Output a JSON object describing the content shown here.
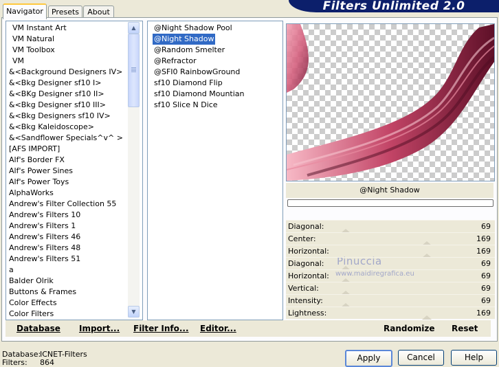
{
  "banner": {
    "title": "Filters Unlimited 2.0"
  },
  "tabs": [
    {
      "label": "Navigator",
      "active": true
    },
    {
      "label": "Presets",
      "active": false
    },
    {
      "label": "About",
      "active": false
    }
  ],
  "categories": [
    "VM Instant Art",
    "VM Natural",
    "VM Toolbox",
    "VM",
    "&<Background Designers IV>",
    "&<Bkg Designer sf10 I>",
    "&<BKg Designer sf10 II>",
    "&<Bkg Designer sf10 III>",
    "&<Bkg Designers sf10 IV>",
    "&<Bkg Kaleidoscope>",
    "&<Sandflower Specials^v^ >",
    "[AFS IMPORT]",
    "Alf's Border FX",
    "Alf's Power Sines",
    "Alf's Power Toys",
    "AlphaWorks",
    "Andrew's Filter Collection 55",
    "Andrew's Filters 10",
    "Andrew's Filters 1",
    "Andrew's Filters 46",
    "Andrew's Filters 48",
    "Andrew's Filters 51",
    "a",
    "Balder Olrik",
    "Buttons & Frames",
    "Color Effects",
    "Color Filters"
  ],
  "filters": [
    "@Night Shadow Pool",
    "@Night Shadow",
    "@Random Smelter",
    "@Refractor",
    "@SFI0 RainbowGround",
    "sf10 Diamond Flip",
    "sf10 Diamond Mountian",
    "sf10 Slice N Dice"
  ],
  "selected_filter": "@Night Shadow",
  "preview": {
    "label": "@Night Shadow",
    "progress": 0
  },
  "sliders": [
    {
      "label": "Diagonal:",
      "value": "69"
    },
    {
      "label": "Center:",
      "value": "169"
    },
    {
      "label": "Horizontal:",
      "value": "169"
    },
    {
      "label": "Diagonal:",
      "value": "69"
    },
    {
      "label": "Horizontal:",
      "value": "69"
    },
    {
      "label": "Vertical:",
      "value": "69"
    },
    {
      "label": "Intensity:",
      "value": "69"
    },
    {
      "label": "Lightness:",
      "value": "169"
    }
  ],
  "links": {
    "database": "Database",
    "import": "Import...",
    "filter_info": "Filter Info...",
    "editor": "Editor...",
    "randomize": "Randomize",
    "reset": "Reset"
  },
  "status": {
    "database_label": "Database:",
    "database_value": "ICNET-Filters",
    "filters_label": "Filters:",
    "filters_value": "864"
  },
  "buttons": {
    "apply": "Apply",
    "cancel": "Cancel",
    "help": "Help"
  },
  "watermark": {
    "line1": "Pinuccia",
    "line2": "www.maidiregrafica.eu"
  },
  "colors": {
    "selection": "#316ac5",
    "banner": "#0c1f6b",
    "accent_tab": "#ffc83c"
  }
}
